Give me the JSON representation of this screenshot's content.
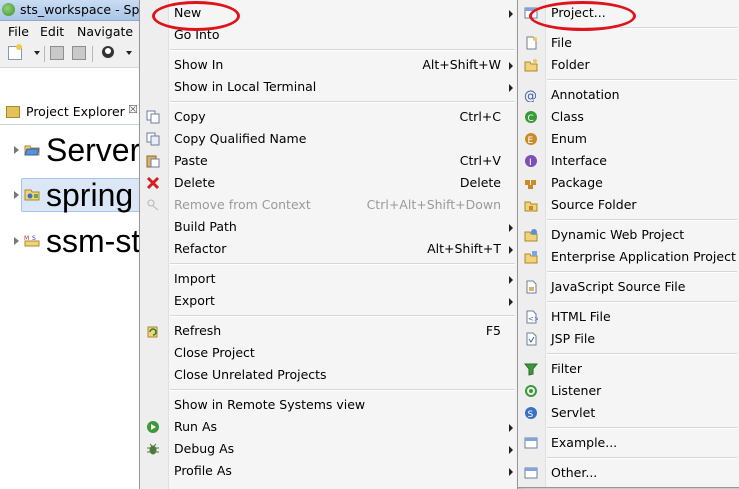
{
  "window": {
    "title": "sts_workspace - Spri"
  },
  "menubar": {
    "file": "File",
    "edit": "Edit",
    "navigate": "Navigate"
  },
  "project_explorer": {
    "tab_title": "Project Explorer",
    "close_glyph": "☒",
    "items": [
      {
        "label": "Server"
      },
      {
        "label": "spring"
      },
      {
        "label": "ssm-st"
      }
    ]
  },
  "context_menu": {
    "new": {
      "label": "New"
    },
    "go_into": {
      "label": "Go Into"
    },
    "show_in": {
      "label": "Show In",
      "shortcut": "Alt+Shift+W"
    },
    "show_in_local_terminal": {
      "label": "Show in Local Terminal"
    },
    "copy": {
      "label": "Copy",
      "shortcut": "Ctrl+C"
    },
    "copy_qualified_name": {
      "label": "Copy Qualified Name"
    },
    "paste": {
      "label": "Paste",
      "shortcut": "Ctrl+V"
    },
    "delete": {
      "label": "Delete",
      "shortcut": "Delete"
    },
    "remove_from_context": {
      "label": "Remove from Context",
      "shortcut": "Ctrl+Alt+Shift+Down"
    },
    "build_path": {
      "label": "Build Path"
    },
    "refactor": {
      "label": "Refactor",
      "shortcut": "Alt+Shift+T"
    },
    "import": {
      "label": "Import"
    },
    "export": {
      "label": "Export"
    },
    "refresh": {
      "label": "Refresh",
      "shortcut": "F5"
    },
    "close_project": {
      "label": "Close Project"
    },
    "close_unrelated_projects": {
      "label": "Close Unrelated Projects"
    },
    "show_in_remote_systems_view": {
      "label": "Show in Remote Systems view"
    },
    "run_as": {
      "label": "Run As"
    },
    "debug_as": {
      "label": "Debug As"
    },
    "profile_as": {
      "label": "Profile As"
    }
  },
  "new_submenu": {
    "project": "Project...",
    "file": "File",
    "folder": "Folder",
    "annotation": "Annotation",
    "class": "Class",
    "enum": "Enum",
    "interface": "Interface",
    "package": "Package",
    "source_folder": "Source Folder",
    "dynamic_web_project": "Dynamic Web Project",
    "enterprise_application_project": "Enterprise Application Project",
    "javascript_source_file": "JavaScript Source File",
    "html_file": "HTML File",
    "jsp_file": "JSP File",
    "filter": "Filter",
    "listener": "Listener",
    "servlet": "Servlet",
    "example": "Example...",
    "other": "Other..."
  },
  "colors": {
    "highlight_ellipse": "#e0131b",
    "selection": "#dbe7f7",
    "menu_bg": "#f5f5f5"
  }
}
